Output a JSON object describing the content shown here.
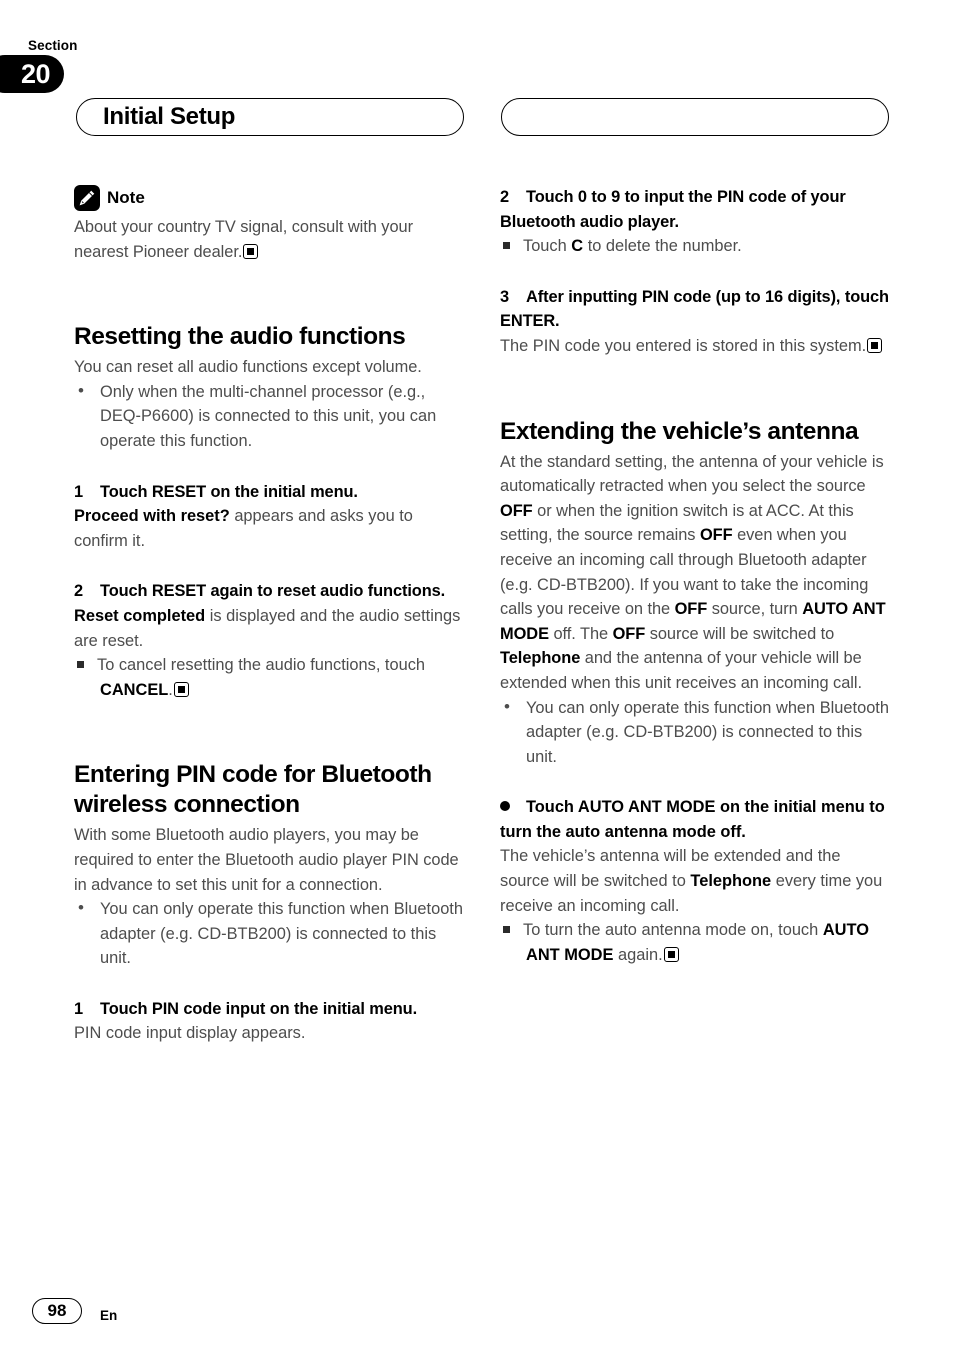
{
  "header": {
    "section_label": "Section",
    "section_number": "20",
    "title": "Initial Setup"
  },
  "footer": {
    "page_number": "98",
    "language": "En"
  },
  "left_column": {
    "note": {
      "icon": "pencil-note-icon",
      "label": "Note",
      "text": "About your country TV signal, consult with your nearest Pioneer dealer."
    },
    "reset_section": {
      "heading": "Resetting the audio functions",
      "intro": "You can reset all audio functions except volume.",
      "bullets": [
        "Only when the multi-channel processor (e.g., DEQ-P6600) is connected to this unit, you can operate this function."
      ],
      "steps": [
        {
          "num": "1",
          "head": "Touch RESET on the initial menu.",
          "body_bold": "Proceed with reset?",
          "body_rest": " appears and asks you to confirm it."
        },
        {
          "num": "2",
          "head": "Touch RESET again to reset audio functions.",
          "body_bold": "Reset completed",
          "body_rest": " is displayed and the audio settings are reset.",
          "remark_pre": "To cancel resetting the audio functions, touch ",
          "remark_bold": "CANCEL",
          "remark_post": "."
        }
      ]
    },
    "pin_section": {
      "heading": "Entering PIN code for Bluetooth wireless connection",
      "intro": "With some Bluetooth audio players, you may be required to enter the Bluetooth audio player PIN code in advance to set this unit for a connection.",
      "bullets": [
        "You can only operate this function when Bluetooth adapter (e.g. CD-BTB200) is connected to this unit."
      ],
      "steps": [
        {
          "num": "1",
          "head": "Touch PIN code input on the initial menu.",
          "body": "PIN code input display appears."
        }
      ]
    }
  },
  "right_column": {
    "pin_steps": [
      {
        "num": "2",
        "head": "Touch 0 to 9 to input the PIN code of your Bluetooth audio player.",
        "remark_pre": "Touch ",
        "remark_bold": "C",
        "remark_post": " to delete the number."
      },
      {
        "num": "3",
        "head": "After inputting PIN code (up to 16 digits), touch ENTER.",
        "body": "The PIN code you entered is stored in this system."
      }
    ],
    "antenna_section": {
      "heading": "Extending the vehicle’s antenna",
      "para_1": "At the standard setting, the antenna of your vehicle is automatically retracted when you select the source ",
      "para_b1": "OFF",
      "para_2": " or when the ignition switch is at ACC. At this setting, the source remains ",
      "para_b2": "OFF",
      "para_3": " even when you receive an incoming call through Bluetooth adapter (e.g. CD-BTB200). If you want to take the incoming calls you receive on the ",
      "para_b3": "OFF",
      "para_4": " source, turn ",
      "para_b4": "AUTO ANT MODE",
      "para_5": " off. The ",
      "para_b5": "OFF",
      "para_6": " source will be switched to ",
      "para_b6": "Telephone",
      "para_7": " and the antenna of your vehicle will be extended when this unit receives an incoming call.",
      "bullets": [
        "You can only operate this function when Bluetooth adapter (e.g. CD-BTB200) is connected to this unit."
      ],
      "dot_step": {
        "head": "Touch AUTO ANT MODE on the initial menu to turn the auto antenna mode off.",
        "body_1": "The vehicle’s antenna will be extended and the source will be switched to ",
        "body_b1": "Telephone",
        "body_2": " every time you receive an incoming call.",
        "remark_pre": "To turn the auto antenna mode on, touch ",
        "remark_bold": "AUTO ANT MODE",
        "remark_post": " again."
      }
    }
  }
}
